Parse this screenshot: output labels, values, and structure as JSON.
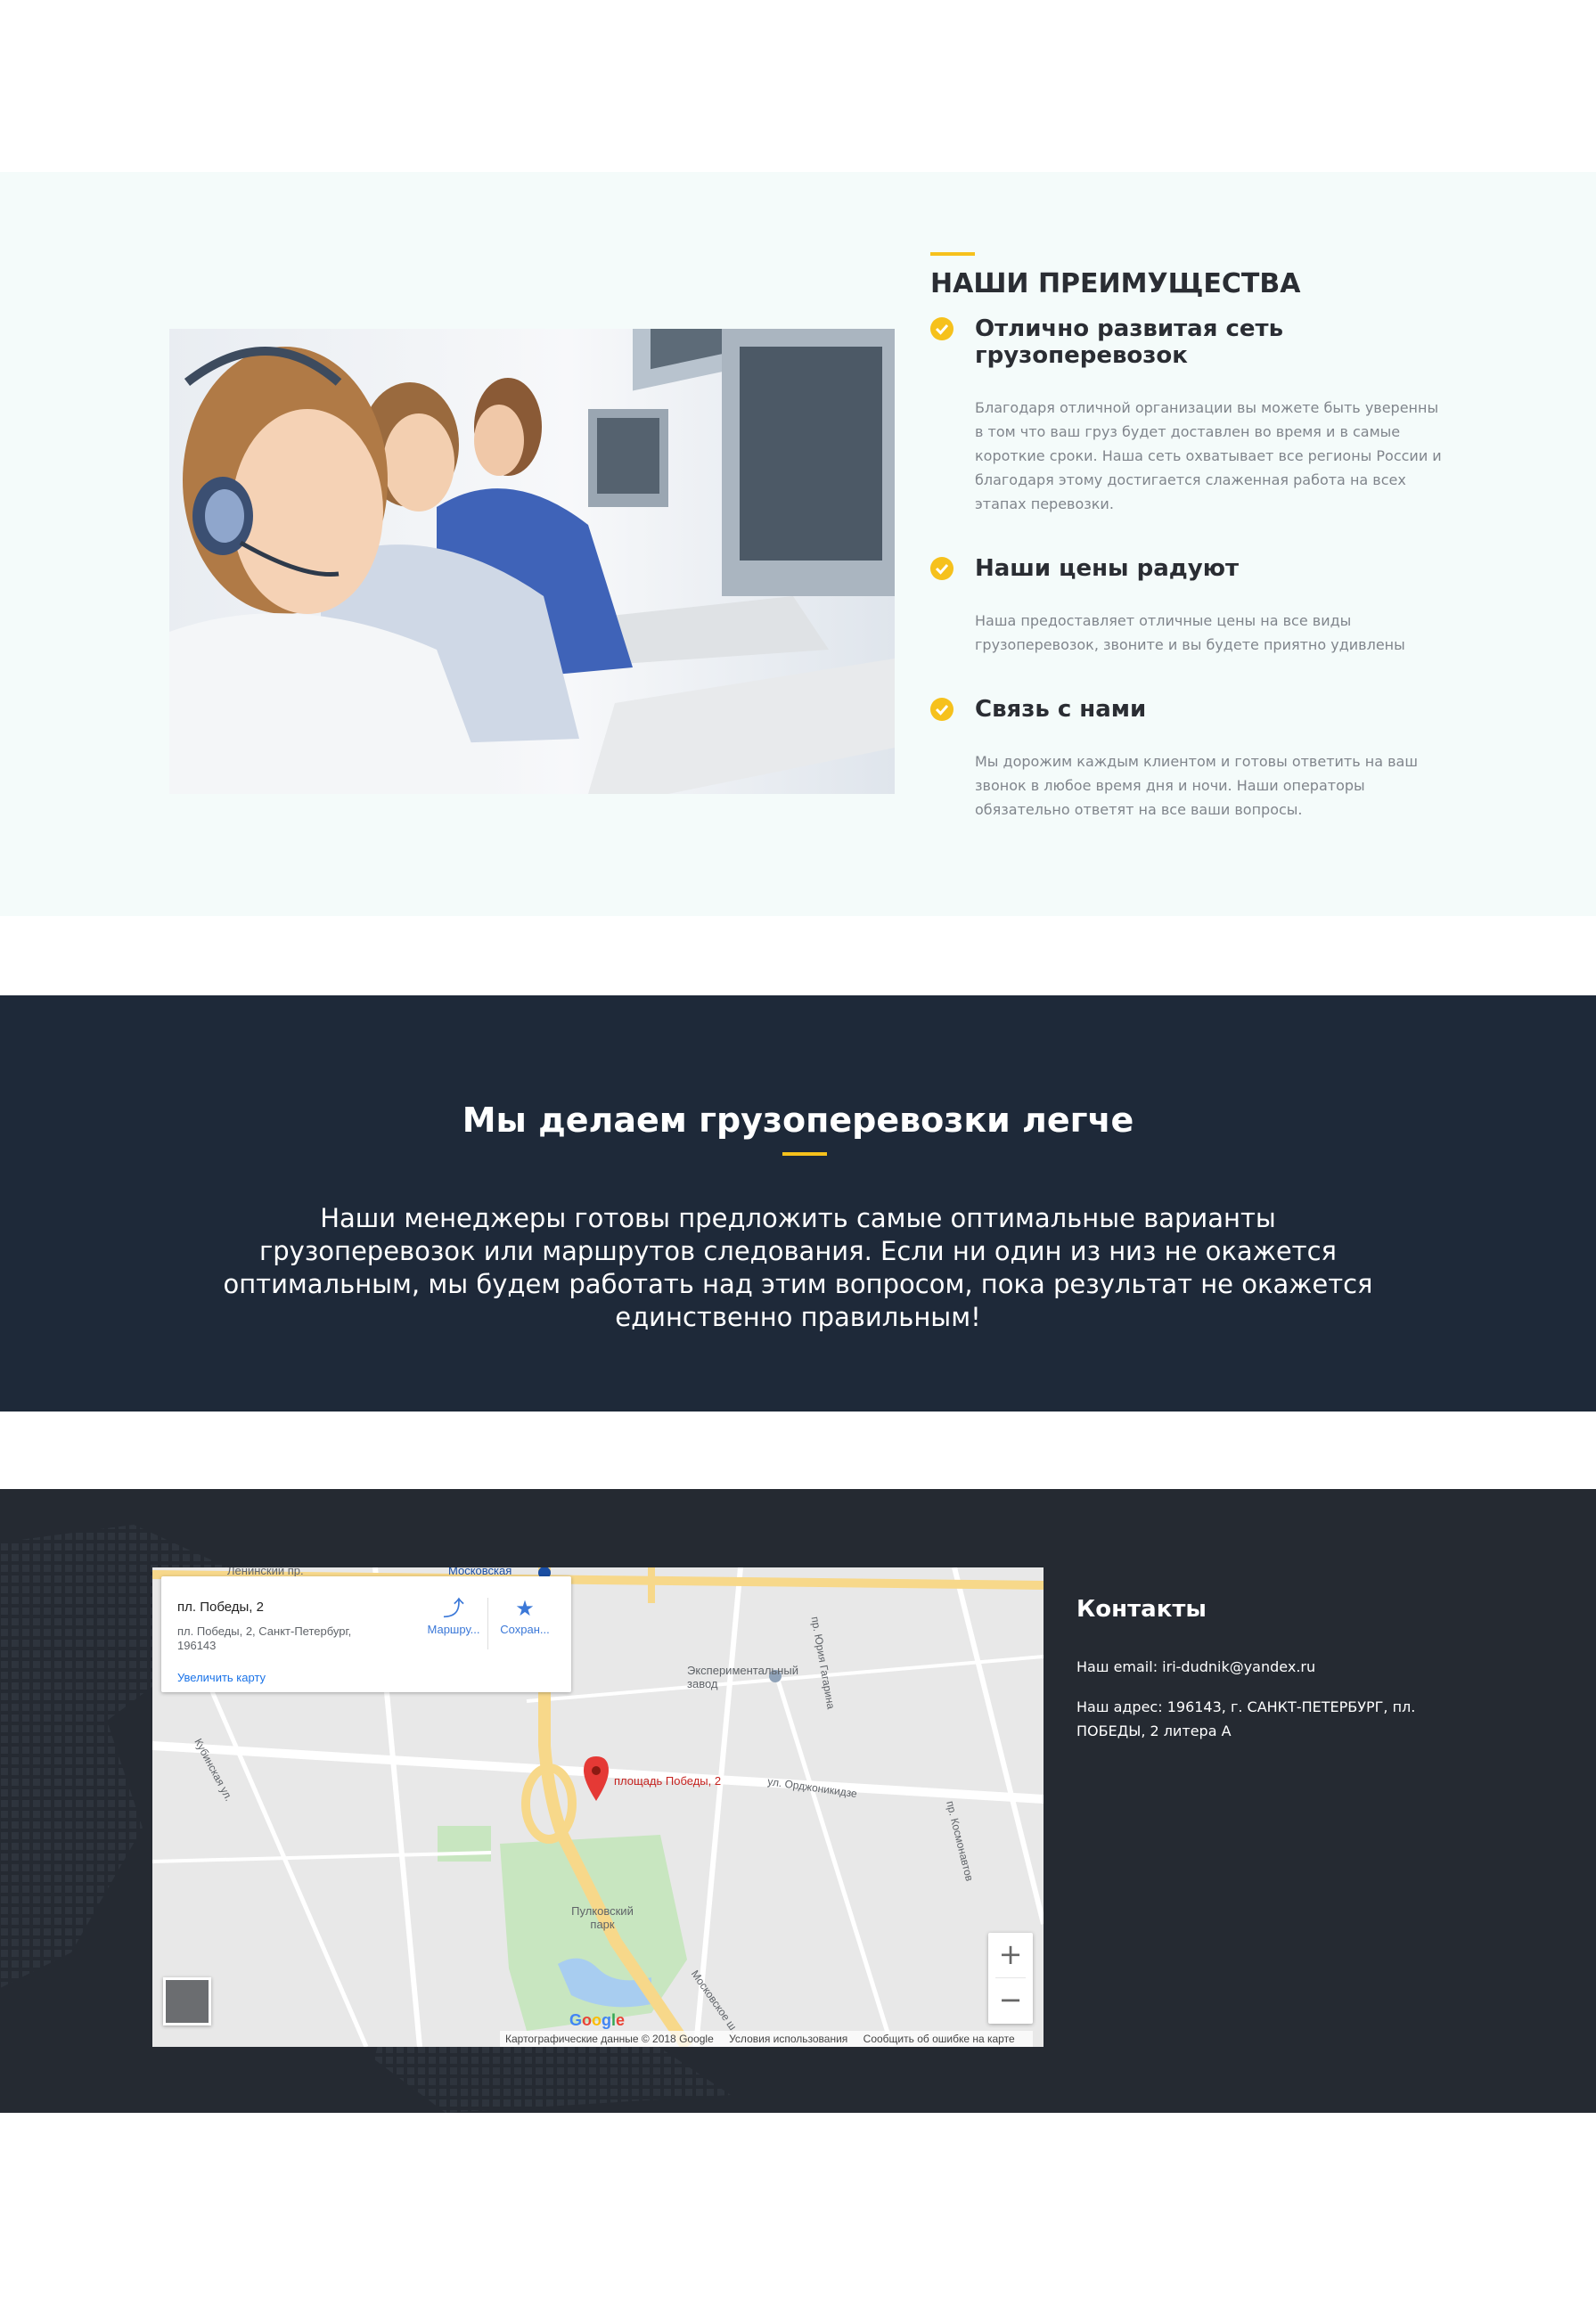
{
  "advantages": {
    "title": "НАШИ ПРЕИМУЩЕСТВА",
    "accent_color": "#f6c11c",
    "items": [
      {
        "title": "Отлично развитая сеть грузоперевозок",
        "text": "Благодаря отличной организации вы можете быть уверенны в том что ваш груз будет доставлен во время и в самые короткие сроки. Наша сеть охватывает все регионы России и благодаря этому достигается слаженная работа на всех этапах перевозки."
      },
      {
        "title": "Наши цены радуют",
        "text": "Наша предоставляет отличные цены на все виды грузоперевозок, звоните и вы будете приятно удивлены"
      },
      {
        "title": "Связь с нами",
        "text": "Мы дорожим каждым клиентом и готовы ответить на ваш звонок в любое время дня и ночи. Наши операторы обязательно ответят на все ваши вопросы."
      }
    ]
  },
  "banner": {
    "title": "Мы делаем грузоперевозки легче",
    "text": "Наши менеджеры готовы предложить самые оптимальные варианты грузоперевозок или маршрутов следования. Если ни один из низ не окажется оптимальным, мы будем работать над этим вопросом, пока результат не окажется единственно правильным!",
    "background": "#1e2939"
  },
  "map": {
    "place_name": "пл. Победы, 2",
    "place_address": "пл. Победы, 2, Санкт-Петербург, 196143",
    "enlarge_link": "Увеличить карту",
    "directions_label": "Маршру...",
    "save_label": "Сохран...",
    "pin_label": "площадь Победы, 2",
    "labels": {
      "leninsky": "Ленинский пр.",
      "moskovskaya": "Московская",
      "factory": "Экспериментальный завод",
      "park": "Пулковский парк",
      "ordzhonikidze": "ул. Орджоникидзе",
      "gagarina": "пр. Юрия Гагарина",
      "kosmonavtov": "пр. Космонавтов",
      "moskovskoe": "Московское ш.",
      "kubinskaya": "Кубинская ул."
    },
    "zoom_in": "+",
    "zoom_out": "−",
    "google": "Google",
    "attribution": [
      "Картографические данные © 2018 Google",
      "Условия использования",
      "Сообщить об ошибке на карте"
    ]
  },
  "contacts": {
    "title": "Контакты",
    "email_line": "Наш email: iri-dudnik@yandex.ru",
    "address_line": "Наш адрес: 196143, г. САНКТ-ПЕТЕРБУРГ, пл. ПОБЕДЫ, 2 литера А"
  },
  "footer_background": "#252a32"
}
